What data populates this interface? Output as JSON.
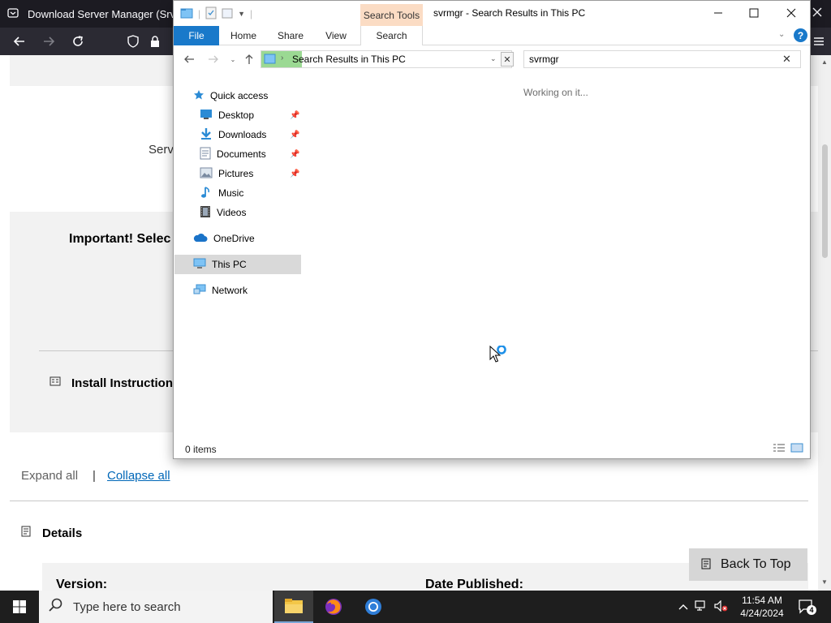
{
  "browser": {
    "tab_title": "Download Server Manager (SrvM",
    "page": {
      "heading_fragment": "Serv",
      "important_fragment": "Important! Selec",
      "install_fragment": "Install Instruction",
      "expand_all": "Expand all",
      "separator": "|",
      "collapse_all": "Collapse all",
      "details": "Details",
      "version_label": "Version:",
      "date_label": "Date Published:",
      "back_to_top": "Back To Top"
    }
  },
  "explorer": {
    "window_title": "svrmgr - Search Results in This PC",
    "contextual_tab": "Search Tools",
    "ribbon_tabs": [
      "File",
      "Home",
      "Share",
      "View",
      "Search"
    ],
    "address": "Search Results in This PC",
    "search_value": "svrmgr",
    "status_message": "Working on it...",
    "item_count": "0 items",
    "nav": {
      "quick_access": "Quick access",
      "items": [
        "Desktop",
        "Downloads",
        "Documents",
        "Pictures",
        "Music",
        "Videos"
      ],
      "onedrive": "OneDrive",
      "this_pc": "This PC",
      "network": "Network"
    }
  },
  "taskbar": {
    "search_placeholder": "Type here to search",
    "time": "11:54 AM",
    "date": "4/24/2024",
    "notification_count": "4"
  },
  "colors": {
    "accent": "#1979ca",
    "contextual_tab": "#fbdcc4",
    "address_highlight": "#9bd993",
    "selection": "#d9d9d9"
  }
}
